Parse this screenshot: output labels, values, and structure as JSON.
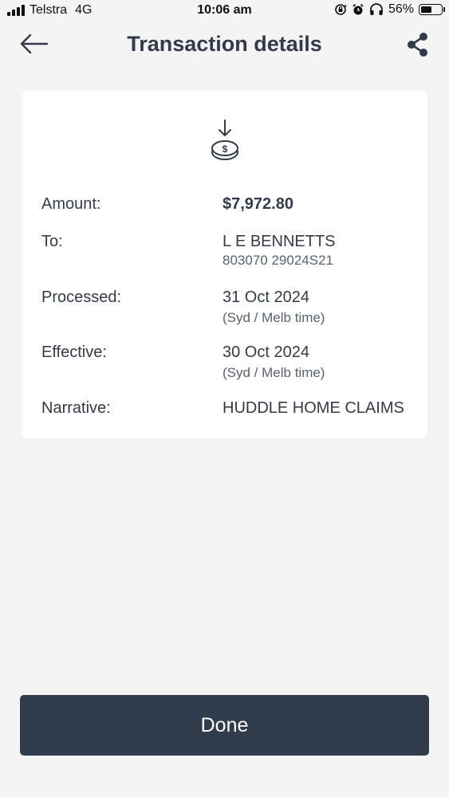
{
  "status_bar": {
    "carrier": "Telstra",
    "network": "4G",
    "time": "10:06 am",
    "battery_percent": "56%",
    "battery_level": 0.56,
    "icons": [
      "signal-icon",
      "screen-rotation-lock-icon",
      "alarm-icon",
      "headphones-icon",
      "battery-icon"
    ]
  },
  "header": {
    "title": "Transaction details",
    "back_icon": "arrow-left-icon",
    "share_icon": "share-icon"
  },
  "card": {
    "icon": "coin-download-icon",
    "amount": {
      "label": "Amount:",
      "value": "$7,972.80"
    },
    "to": {
      "label": "To:",
      "value": "L E BENNETTS",
      "sub": "803070 29024S21"
    },
    "processed": {
      "label": "Processed:",
      "value": "31 Oct 2024",
      "sub": "(Syd / Melb time)"
    },
    "effective": {
      "label": "Effective:",
      "value": "30 Oct 2024",
      "sub": "(Syd / Melb time)"
    },
    "narrative": {
      "label": "Narrative:",
      "value": "HUDDLE HOME CLAIMS"
    }
  },
  "footer": {
    "done_label": "Done"
  },
  "colors": {
    "background": "#f4f4f4",
    "card": "#ffffff",
    "text": "#333b4a",
    "button": "#313c4c"
  }
}
